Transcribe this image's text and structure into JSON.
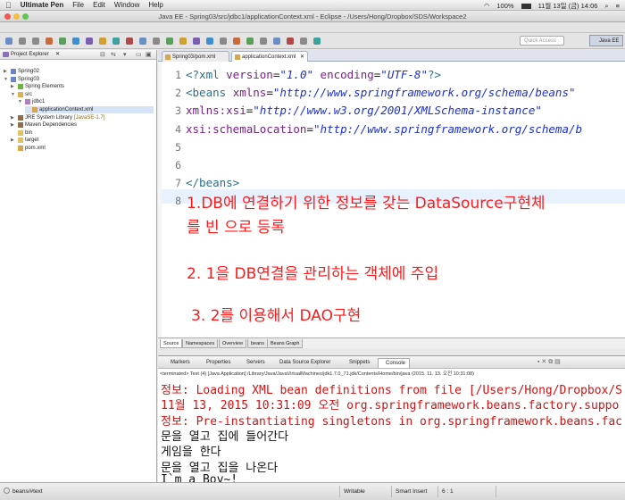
{
  "menubar": {
    "app_name": "Ultimate Pen",
    "items": [
      "File",
      "Edit",
      "Window",
      "Help"
    ],
    "battery": "100%",
    "clock": "11월 13일 (금) 14:06"
  },
  "window": {
    "title": "Java EE - Spring03/src/jdbc1/applicationContext.xml - Eclipse - /Users/Hong/Dropbox/SDS/Workspace2"
  },
  "toolbar": {
    "quick_access_placeholder": "Quick Access",
    "perspective": "Java EE"
  },
  "explorer": {
    "title": "Project Explorer",
    "tree": [
      {
        "label": "Spring02",
        "indent": 0,
        "open": false,
        "icon": "project-icon"
      },
      {
        "label": "Spring03",
        "indent": 0,
        "open": true,
        "icon": "project-icon"
      },
      {
        "label": "Spring Elements",
        "indent": 1,
        "open": false,
        "icon": "spring-icon"
      },
      {
        "label": "src",
        "indent": 1,
        "open": true,
        "icon": "source-folder-icon"
      },
      {
        "label": "jdbc1",
        "indent": 2,
        "open": true,
        "icon": "package-icon"
      },
      {
        "label": "applicationContext.xml",
        "indent": 3,
        "open": null,
        "icon": "xml-file-icon",
        "selected": true
      },
      {
        "label": "JRE System Library",
        "suffix": "[JavaSE-1.7]",
        "indent": 1,
        "open": false,
        "icon": "library-icon"
      },
      {
        "label": "Maven Dependencies",
        "indent": 1,
        "open": false,
        "icon": "library-icon"
      },
      {
        "label": "bin",
        "indent": 1,
        "open": null,
        "icon": "folder-icon"
      },
      {
        "label": "target",
        "indent": 1,
        "open": false,
        "icon": "folder-icon"
      },
      {
        "label": "pom.xml",
        "indent": 1,
        "open": null,
        "icon": "xml-file-icon"
      }
    ]
  },
  "editor": {
    "tabs": [
      "Spring03/pom.xml",
      "applicationContext.xml"
    ],
    "active_tab": 1,
    "lines": [
      {
        "num": "1",
        "parts": [
          [
            "tag",
            "<?xml "
          ],
          [
            "att",
            "version"
          ],
          [
            "txt",
            "="
          ],
          [
            "str",
            "\"1.0\""
          ],
          [
            "txt",
            " "
          ],
          [
            "att",
            "encoding"
          ],
          [
            "txt",
            "="
          ],
          [
            "str",
            "\"UTF-8\""
          ],
          [
            "tag",
            "?>"
          ]
        ]
      },
      {
        "num": "2",
        "parts": [
          [
            "tag",
            "<beans "
          ],
          [
            "att",
            "xmlns"
          ],
          [
            "txt",
            "="
          ],
          [
            "str",
            "\"http://www.springframework.org/schema/beans\""
          ]
        ]
      },
      {
        "num": "3",
        "parts": [
          [
            "txt",
            "    "
          ],
          [
            "att",
            "xmlns:xsi"
          ],
          [
            "txt",
            "="
          ],
          [
            "str",
            "\"http://www.w3.org/2001/XMLSchema-instance\""
          ]
        ]
      },
      {
        "num": "4",
        "parts": [
          [
            "txt",
            "    "
          ],
          [
            "att",
            "xsi:schemaLocation"
          ],
          [
            "txt",
            "="
          ],
          [
            "str",
            "\"http://www.springframework.org/schema/b"
          ]
        ]
      },
      {
        "num": "5",
        "parts": []
      },
      {
        "num": "6",
        "parts": []
      },
      {
        "num": "7",
        "parts": [
          [
            "tag",
            "</beans>"
          ]
        ]
      },
      {
        "num": "8",
        "parts": []
      }
    ],
    "notes": [
      "1.DB에 연결하기 위한 정보를 갖는 DataSource구현체",
      "를 빈 으로 등록",
      "2. 1을 DB연결을 관리하는 객체에 주입",
      "3. 2를 이용해서 DAO구현"
    ],
    "bottom_tabs": [
      "Source",
      "Namespaces",
      "Overview",
      "beans",
      "Beans Graph"
    ]
  },
  "console": {
    "tabs": [
      "Markers",
      "Properties",
      "Servers",
      "Data Source Explorer",
      "Snippets",
      "Console"
    ],
    "active_tab": 5,
    "terminated": "<terminated> Test (4) [Java Application] /Library/Java/JavaVirtualMachines/jdk1.7.0_71.jdk/Contents/Home/bin/java (2015. 11. 13. 오전 10:31:08)",
    "lines": [
      {
        "text": "정보: Loading XML bean definitions from file [/Users/Hong/Dropbox/S",
        "color": "red"
      },
      {
        "text": "11월 13, 2015 10:31:09 오전 org.springframework.beans.factory.suppo",
        "color": "red"
      },
      {
        "text": "정보: Pre-instantiating singletons in org.springframework.beans.fac",
        "color": "red"
      },
      {
        "text": "문을 열고 집에 들어간다",
        "color": "black"
      },
      {
        "text": "게임을 한다",
        "color": "black"
      },
      {
        "text": "문을 열고 집을 나온다",
        "color": "black"
      },
      {
        "text": "I`m a Boy~!",
        "color": "black"
      }
    ]
  },
  "status": {
    "path": "beans/#text",
    "mode": "Writable",
    "insert": "Smart Insert",
    "position": "6 : 1"
  }
}
